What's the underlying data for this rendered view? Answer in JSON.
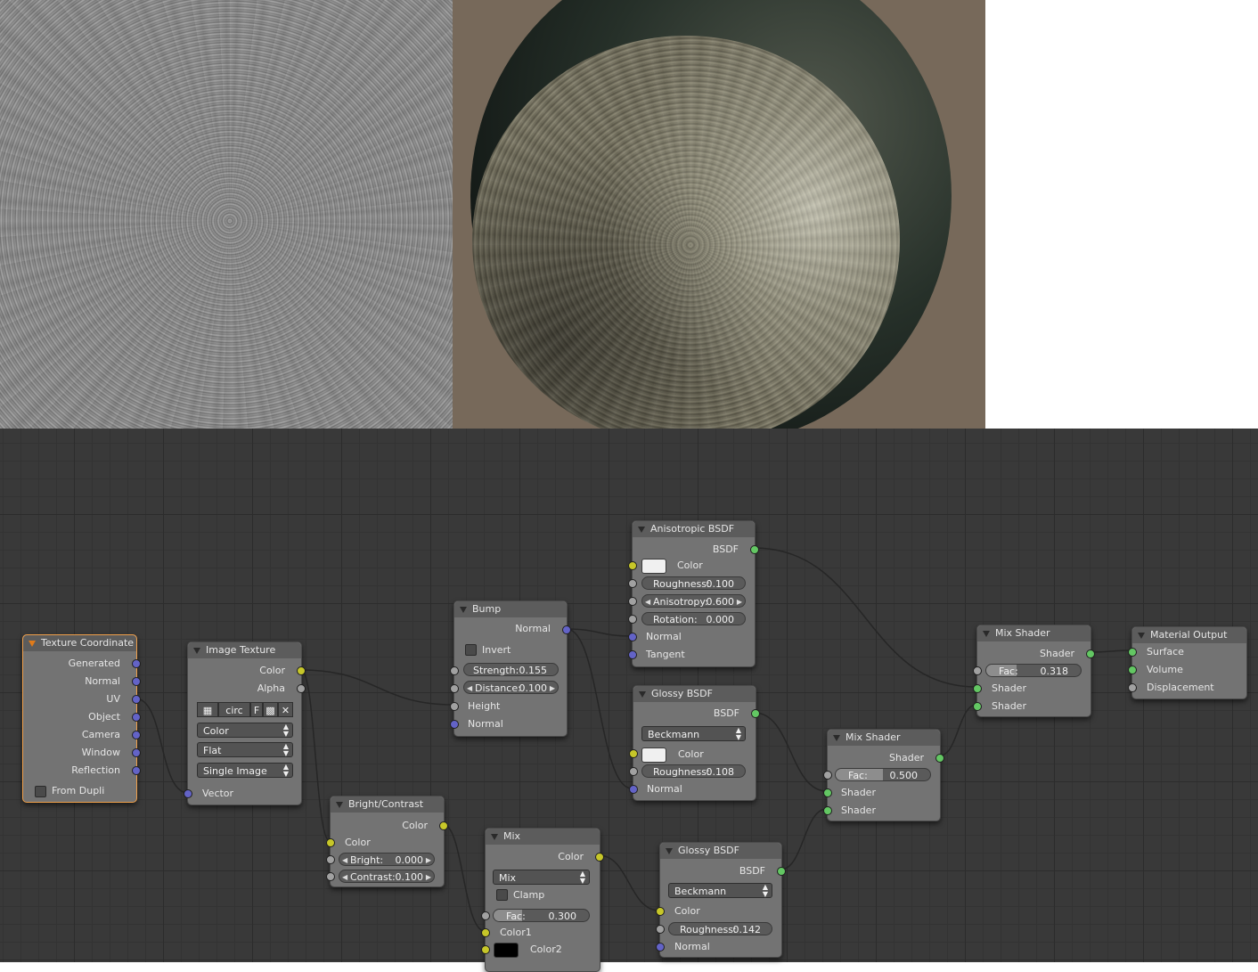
{
  "nodes": {
    "texture_coordinate": {
      "title": "Texture Coordinate",
      "outputs": [
        "Generated",
        "Normal",
        "UV",
        "Object",
        "Camera",
        "Window",
        "Reflection"
      ],
      "from_dupli": "From Dupli"
    },
    "image_texture": {
      "title": "Image Texture",
      "outputs": [
        "Color",
        "Alpha"
      ],
      "image_name": "circ",
      "fake_user": "F",
      "color_space": "Color",
      "projection": "Flat",
      "source": "Single Image",
      "input_vector": "Vector"
    },
    "bump": {
      "title": "Bump",
      "output_normal": "Normal",
      "invert": "Invert",
      "strength_label": "Strength:",
      "strength_value": "0.155",
      "distance_label": "Distance:",
      "distance_value": "0.100",
      "input_height": "Height",
      "input_normal": "Normal"
    },
    "anisotropic_bsdf": {
      "title": "Anisotropic BSDF",
      "output": "BSDF",
      "color_label": "Color",
      "roughness_label": "Roughness:",
      "roughness_value": "0.100",
      "anisotropy_label": "Anisotropy:",
      "anisotropy_value": "0.600",
      "rotation_label": "Rotation:",
      "rotation_value": "0.000",
      "input_normal": "Normal",
      "input_tangent": "Tangent"
    },
    "glossy_bsdf_1": {
      "title": "Glossy BSDF",
      "output": "BSDF",
      "distribution": "Beckmann",
      "color_label": "Color",
      "roughness_label": "Roughness:",
      "roughness_value": "0.108",
      "input_normal": "Normal"
    },
    "glossy_bsdf_2": {
      "title": "Glossy BSDF",
      "output": "BSDF",
      "distribution": "Beckmann",
      "color_label": "Color",
      "roughness_label": "Roughness:",
      "roughness_value": "0.142",
      "input_normal": "Normal"
    },
    "bright_contrast": {
      "title": "Bright/Contrast",
      "output": "Color",
      "input_color": "Color",
      "bright_label": "Bright:",
      "bright_value": "0.000",
      "contrast_label": "Contrast:",
      "contrast_value": "0.100"
    },
    "mix": {
      "title": "Mix",
      "output": "Color",
      "blend_type": "Mix",
      "clamp": "Clamp",
      "fac_label": "Fac:",
      "fac_value": "0.300",
      "fac_fraction": 0.3,
      "color1": "Color1",
      "color2": "Color2"
    },
    "mix_shader_1": {
      "title": "Mix Shader",
      "output": "Shader",
      "fac_label": "Fac:",
      "fac_value": "0.500",
      "fac_fraction": 0.5,
      "input_shader_a": "Shader",
      "input_shader_b": "Shader"
    },
    "mix_shader_2": {
      "title": "Mix Shader",
      "output": "Shader",
      "fac_label": "Fac:",
      "fac_value": "0.318",
      "fac_fraction": 0.318,
      "input_shader_a": "Shader",
      "input_shader_b": "Shader"
    },
    "material_output": {
      "title": "Material Output",
      "input_surface": "Surface",
      "input_volume": "Volume",
      "input_displacement": "Displacement"
    }
  },
  "colors": {
    "editor_background": "#393939",
    "node_body": "#737373",
    "node_header": "#5c5c5c",
    "active_node_outline": "#f0a04a",
    "socket_color": "#c7c729",
    "socket_float": "#a1a1a1",
    "socket_vector": "#6363c7",
    "socket_shader": "#63c763",
    "anisotropic_color_value": "#f0f0f0",
    "glossy_color_value": "#f0f0f0",
    "mix_color2_value": "#000000",
    "render_background": "#77695a"
  }
}
